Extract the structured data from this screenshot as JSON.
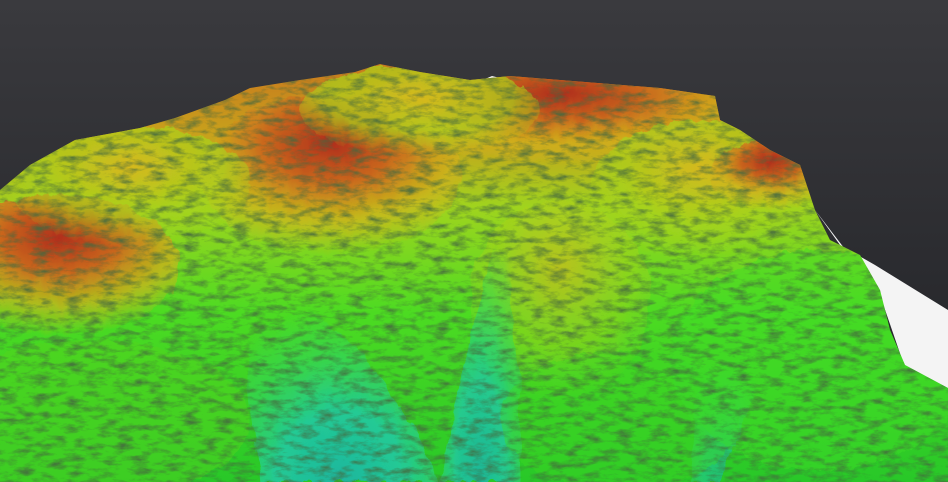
{
  "scene": {
    "subject": "terrain-elevation-render",
    "colors": {
      "background_top": "#3a3a3e",
      "background_bottom": "#1f2024",
      "base_plane": "#f4f4f4",
      "valley_low": "#1fbfa0",
      "mid_green": "#3fdc28",
      "lime": "#b6e41a",
      "yellow": "#d9c21a",
      "orange": "#d7781a",
      "peak_red": "#b1321c",
      "shadow": "#142410"
    }
  }
}
